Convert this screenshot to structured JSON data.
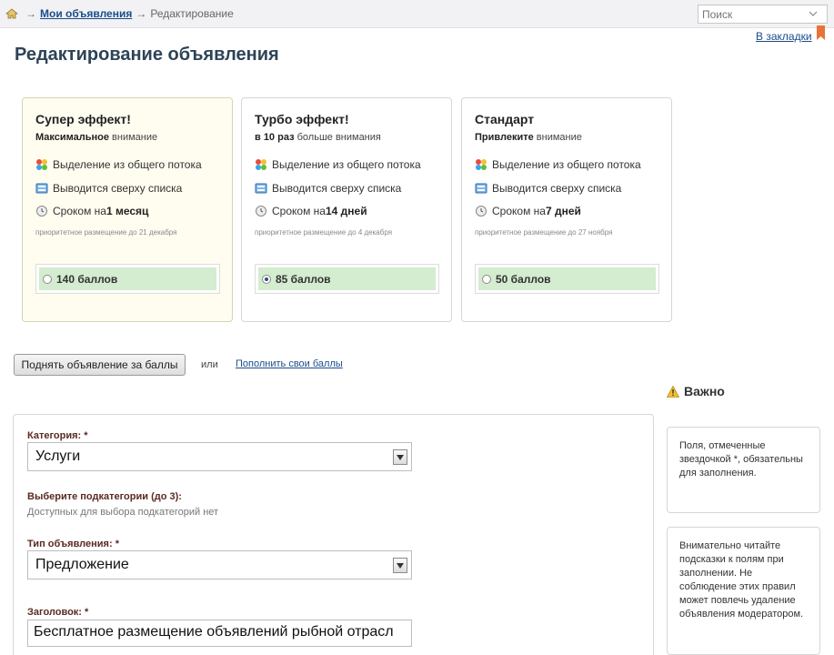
{
  "breadcrumb": {
    "my_ads": "Мои объявления",
    "current": "Редактирование",
    "arrow": "→"
  },
  "search": {
    "placeholder": "Поиск"
  },
  "bookmark": {
    "label": "В закладки"
  },
  "page_title": "Редактирование объявления",
  "plans": [
    {
      "title": "Супер эффект!",
      "subtitle_bold": "Максимальное",
      "subtitle_rest": " внимание",
      "feature1": "Выделение из общего потока",
      "feature2": "Выводится сверху списка",
      "feature3_prefix": "Сроком на ",
      "feature3_bold": "1 месяц",
      "note": "приоритетное размещение до 21 декабря",
      "price": "140 баллов",
      "selected": false
    },
    {
      "title": "Турбо эффект!",
      "subtitle_bold": "в 10 раз",
      "subtitle_rest": " больше внимания",
      "feature1": "Выделение из общего потока",
      "feature2": "Выводится сверху списка",
      "feature3_prefix": "Сроком на ",
      "feature3_bold": "14 дней",
      "note": "приоритетное размещение до 4 декабря",
      "price": "85 баллов",
      "selected": true
    },
    {
      "title": "Стандарт",
      "subtitle_bold": "Привлеките",
      "subtitle_rest": " внимание",
      "feature1": "Выделение из общего потока",
      "feature2": "Выводится сверху списка",
      "feature3_prefix": "Сроком на ",
      "feature3_bold": "7 дней",
      "note": "приоритетное размещение до 27 ноября",
      "price": "50 баллов",
      "selected": false
    }
  ],
  "actions": {
    "raise_button": "Поднять объявление за баллы",
    "or": "или",
    "topup_link": "Пополнить свои баллы"
  },
  "important": {
    "heading": "Важно",
    "note1": "Поля, отмеченные звездочкой *, обязательны для заполнения.",
    "note2": "Внимательно читайте подсказки к полям при заполнении. Не соблюдение этих правил может повлечь удаление объявления модератором."
  },
  "form": {
    "category_label": "Категория: *",
    "category_value": "Услуги",
    "subcat_label": "Выберите подкатегории (до 3):",
    "subcat_hint": "Доступных для выбора подкатегорий нет",
    "type_label": "Тип объявления: *",
    "type_value": "Предложение",
    "title_label": "Заголовок: *",
    "title_value": "Бесплатное размещение объявлений рыбной отрасл"
  },
  "colors": {
    "link": "#1a4d8a",
    "title": "#2d4356",
    "price_bg": "#d4ecd0",
    "highlight_bg": "#fffdf0",
    "field_label": "#5a2a22"
  }
}
